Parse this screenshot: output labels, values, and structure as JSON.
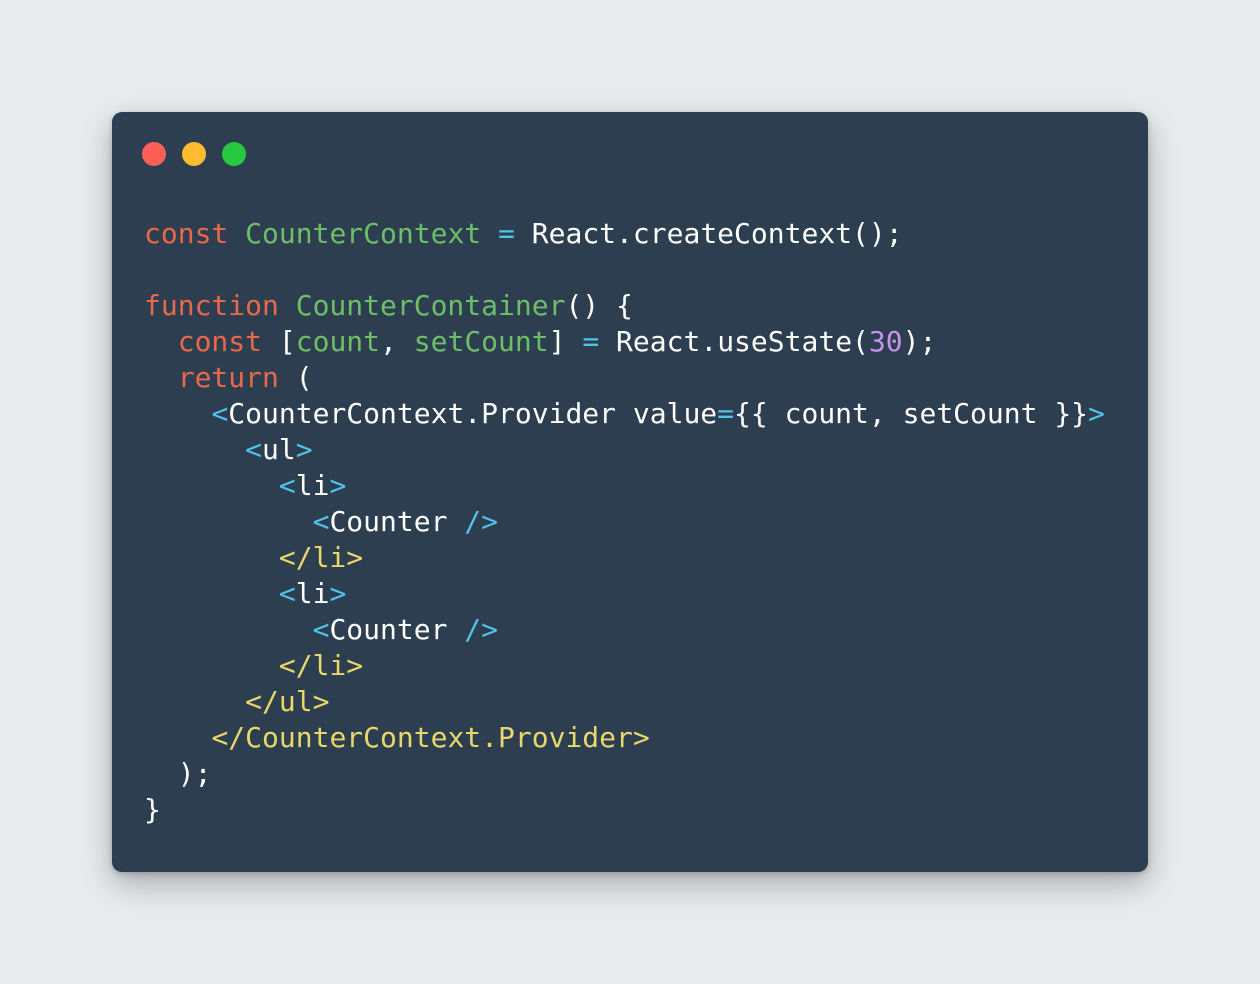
{
  "window": {
    "colors": {
      "page_background": "#e8ecee",
      "window_background": "#2c3e50",
      "close_dot": "#ff5f57",
      "minimize_dot": "#febc2e",
      "maximize_dot": "#28c840"
    }
  },
  "code": {
    "token_colors": {
      "plain": "#ffffff",
      "keyword": "#e8684a",
      "ident": "#6dbf67",
      "op": "#4fc3e8",
      "number": "#c792ea",
      "tag-open": "#4fc3e8",
      "tag-close": "#e8d86a"
    },
    "lines": [
      [
        {
          "t": "const",
          "c": "keyword"
        },
        {
          "t": " ",
          "c": "plain"
        },
        {
          "t": "CounterContext",
          "c": "ident"
        },
        {
          "t": " ",
          "c": "plain"
        },
        {
          "t": "=",
          "c": "op"
        },
        {
          "t": " React.createContext();",
          "c": "plain"
        }
      ],
      [],
      [
        {
          "t": "function",
          "c": "keyword"
        },
        {
          "t": " ",
          "c": "plain"
        },
        {
          "t": "CounterContainer",
          "c": "ident"
        },
        {
          "t": "() {",
          "c": "plain"
        }
      ],
      [
        {
          "t": "  ",
          "c": "plain"
        },
        {
          "t": "const",
          "c": "keyword"
        },
        {
          "t": " [",
          "c": "plain"
        },
        {
          "t": "count",
          "c": "ident"
        },
        {
          "t": ", ",
          "c": "plain"
        },
        {
          "t": "setCount",
          "c": "ident"
        },
        {
          "t": "] ",
          "c": "plain"
        },
        {
          "t": "=",
          "c": "op"
        },
        {
          "t": " React.useState(",
          "c": "plain"
        },
        {
          "t": "30",
          "c": "number"
        },
        {
          "t": ");",
          "c": "plain"
        }
      ],
      [
        {
          "t": "  ",
          "c": "plain"
        },
        {
          "t": "return",
          "c": "keyword"
        },
        {
          "t": " (",
          "c": "plain"
        }
      ],
      [
        {
          "t": "    ",
          "c": "plain"
        },
        {
          "t": "<",
          "c": "tag-open"
        },
        {
          "t": "CounterContext.Provider value",
          "c": "plain"
        },
        {
          "t": "=",
          "c": "op"
        },
        {
          "t": "{{ count, setCount }}",
          "c": "plain"
        },
        {
          "t": ">",
          "c": "tag-open"
        }
      ],
      [
        {
          "t": "      ",
          "c": "plain"
        },
        {
          "t": "<",
          "c": "tag-open"
        },
        {
          "t": "ul",
          "c": "plain"
        },
        {
          "t": ">",
          "c": "tag-open"
        }
      ],
      [
        {
          "t": "        ",
          "c": "plain"
        },
        {
          "t": "<",
          "c": "tag-open"
        },
        {
          "t": "li",
          "c": "plain"
        },
        {
          "t": ">",
          "c": "tag-open"
        }
      ],
      [
        {
          "t": "          ",
          "c": "plain"
        },
        {
          "t": "<",
          "c": "tag-open"
        },
        {
          "t": "Counter ",
          "c": "plain"
        },
        {
          "t": "/>",
          "c": "tag-open"
        }
      ],
      [
        {
          "t": "        ",
          "c": "plain"
        },
        {
          "t": "</li>",
          "c": "tag-close"
        }
      ],
      [
        {
          "t": "        ",
          "c": "plain"
        },
        {
          "t": "<",
          "c": "tag-open"
        },
        {
          "t": "li",
          "c": "plain"
        },
        {
          "t": ">",
          "c": "tag-open"
        }
      ],
      [
        {
          "t": "          ",
          "c": "plain"
        },
        {
          "t": "<",
          "c": "tag-open"
        },
        {
          "t": "Counter ",
          "c": "plain"
        },
        {
          "t": "/>",
          "c": "tag-open"
        }
      ],
      [
        {
          "t": "        ",
          "c": "plain"
        },
        {
          "t": "</li>",
          "c": "tag-close"
        }
      ],
      [
        {
          "t": "      ",
          "c": "plain"
        },
        {
          "t": "</ul>",
          "c": "tag-close"
        }
      ],
      [
        {
          "t": "    ",
          "c": "plain"
        },
        {
          "t": "</CounterContext.Provider>",
          "c": "tag-close"
        }
      ],
      [
        {
          "t": "  );",
          "c": "plain"
        }
      ],
      [
        {
          "t": "}",
          "c": "plain"
        }
      ]
    ]
  }
}
